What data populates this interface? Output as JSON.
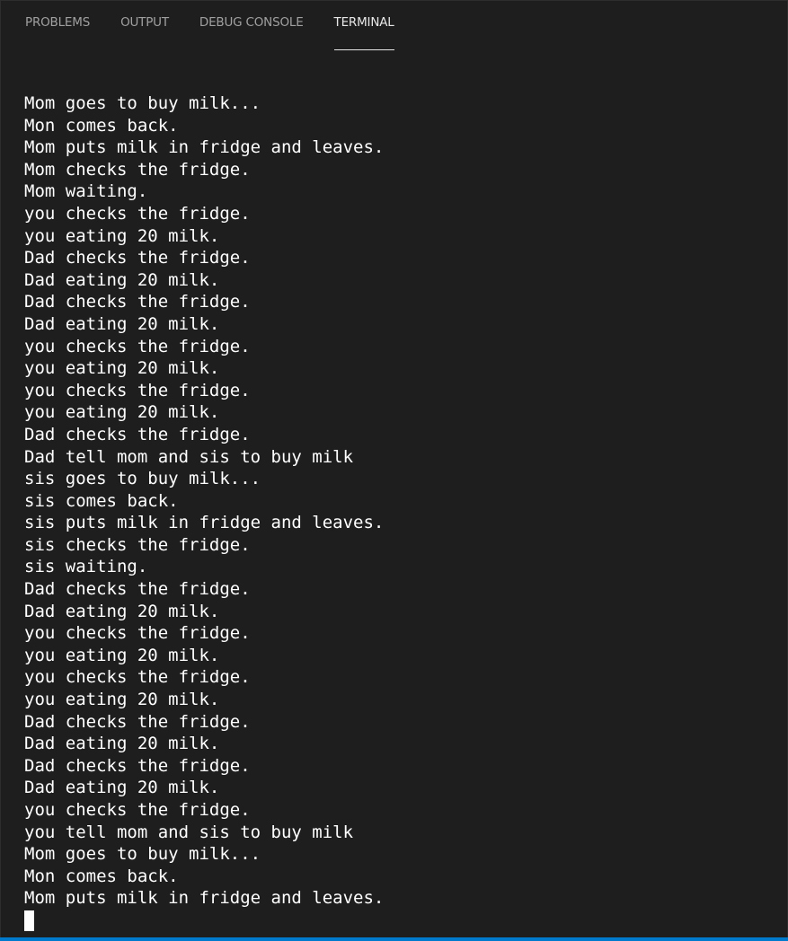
{
  "panel": {
    "tabs": [
      {
        "label": "PROBLEMS"
      },
      {
        "label": "OUTPUT"
      },
      {
        "label": "DEBUG CONSOLE"
      },
      {
        "label": "TERMINAL",
        "active": true
      }
    ]
  },
  "terminal": {
    "lines": [
      "Mom goes to buy milk...",
      "Mon comes back.",
      "Mom puts milk in fridge and leaves.",
      "Mom checks the fridge.",
      "Mom waiting.",
      "you checks the fridge.",
      "you eating 20 milk.",
      "Dad checks the fridge.",
      "Dad eating 20 milk.",
      "Dad checks the fridge.",
      "Dad eating 20 milk.",
      "you checks the fridge.",
      "you eating 20 milk.",
      "you checks the fridge.",
      "you eating 20 milk.",
      "Dad checks the fridge.",
      "Dad tell mom and sis to buy milk",
      "sis goes to buy milk...",
      "sis comes back.",
      "sis puts milk in fridge and leaves.",
      "sis checks the fridge.",
      "sis waiting.",
      "Dad checks the fridge.",
      "Dad eating 20 milk.",
      "you checks the fridge.",
      "you eating 20 milk.",
      "you checks the fridge.",
      "you eating 20 milk.",
      "Dad checks the fridge.",
      "Dad eating 20 milk.",
      "Dad checks the fridge.",
      "Dad eating 20 milk.",
      "you checks the fridge.",
      "you tell mom and sis to buy milk",
      "Mom goes to buy milk...",
      "Mon comes back.",
      "Mom puts milk in fridge and leaves."
    ]
  },
  "colors": {
    "background": "#1e1e1e",
    "tab_inactive": "#a0a0a0",
    "tab_active": "#e7e7e7",
    "terminal_text": "#ffffff",
    "status_bar": "#007acc"
  }
}
